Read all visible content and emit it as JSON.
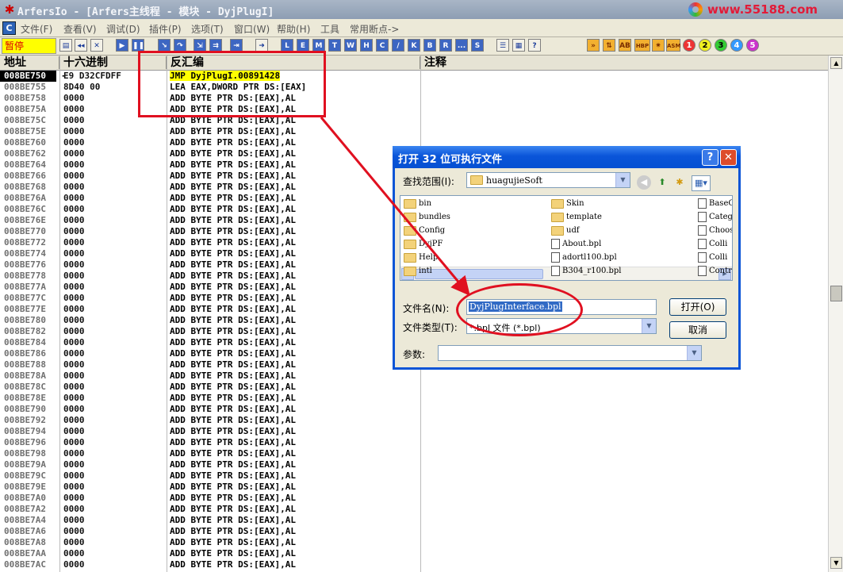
{
  "window": {
    "title": "ArfersIo - [Arfers主线程 - 模块 - DyjPlugI]",
    "watermark": "www.55188.com"
  },
  "menu": [
    "文件(F)",
    "查看(V)",
    "调试(D)",
    "插件(P)",
    "选项(T)",
    "窗口(W)",
    "帮助(H)",
    "工具",
    "常用断点->"
  ],
  "toolbar": {
    "status": "暂停",
    "letter_buttons": [
      "L",
      "E",
      "M",
      "T",
      "W",
      "H",
      "C",
      "/",
      "K",
      "B",
      "R",
      "...",
      "S"
    ],
    "right_buttons": [
      "HBP",
      "ASM",
      "1",
      "2",
      "3",
      "4",
      "5"
    ]
  },
  "columns": {
    "address": "地址",
    "hex": "十六进制",
    "disasm": "反汇编",
    "comment": "注释"
  },
  "rows": [
    {
      "addr": "008BE750",
      "mark": "-",
      "hex": "E9 D32CFDFF",
      "dis": "JMP DyjPlugI.00891428",
      "sel": true
    },
    {
      "addr": "008BE755",
      "hex": "8D40 00",
      "dis": "LEA EAX,DWORD PTR DS:[EAX]"
    },
    {
      "addr": "008BE758",
      "hex": "0000",
      "dis": "ADD BYTE PTR DS:[EAX],AL"
    },
    {
      "addr": "008BE75A",
      "hex": "0000",
      "dis": "ADD BYTE PTR DS:[EAX],AL"
    },
    {
      "addr": "008BE75C",
      "hex": "0000",
      "dis": "ADD BYTE PTR DS:[EAX],AL"
    },
    {
      "addr": "008BE75E",
      "hex": "0000",
      "dis": "ADD BYTE PTR DS:[EAX],AL"
    },
    {
      "addr": "008BE760",
      "hex": "0000",
      "dis": "ADD BYTE PTR DS:[EAX],AL"
    },
    {
      "addr": "008BE762",
      "hex": "0000",
      "dis": "ADD BYTE PTR DS:[EAX],AL"
    },
    {
      "addr": "008BE764",
      "hex": "0000",
      "dis": "ADD BYTE PTR DS:[EAX],AL"
    },
    {
      "addr": "008BE766",
      "hex": "0000",
      "dis": "ADD BYTE PTR DS:[EAX],AL"
    },
    {
      "addr": "008BE768",
      "hex": "0000",
      "dis": "ADD BYTE PTR DS:[EAX],AL"
    },
    {
      "addr": "008BE76A",
      "hex": "0000",
      "dis": "ADD BYTE PTR DS:[EAX],AL"
    },
    {
      "addr": "008BE76C",
      "hex": "0000",
      "dis": "ADD BYTE PTR DS:[EAX],AL"
    },
    {
      "addr": "008BE76E",
      "hex": "0000",
      "dis": "ADD BYTE PTR DS:[EAX],AL"
    },
    {
      "addr": "008BE770",
      "hex": "0000",
      "dis": "ADD BYTE PTR DS:[EAX],AL"
    },
    {
      "addr": "008BE772",
      "hex": "0000",
      "dis": "ADD BYTE PTR DS:[EAX],AL"
    },
    {
      "addr": "008BE774",
      "hex": "0000",
      "dis": "ADD BYTE PTR DS:[EAX],AL"
    },
    {
      "addr": "008BE776",
      "hex": "0000",
      "dis": "ADD BYTE PTR DS:[EAX],AL"
    },
    {
      "addr": "008BE778",
      "hex": "0000",
      "dis": "ADD BYTE PTR DS:[EAX],AL"
    },
    {
      "addr": "008BE77A",
      "hex": "0000",
      "dis": "ADD BYTE PTR DS:[EAX],AL"
    },
    {
      "addr": "008BE77C",
      "hex": "0000",
      "dis": "ADD BYTE PTR DS:[EAX],AL"
    },
    {
      "addr": "008BE77E",
      "hex": "0000",
      "dis": "ADD BYTE PTR DS:[EAX],AL"
    },
    {
      "addr": "008BE780",
      "hex": "0000",
      "dis": "ADD BYTE PTR DS:[EAX],AL"
    },
    {
      "addr": "008BE782",
      "hex": "0000",
      "dis": "ADD BYTE PTR DS:[EAX],AL"
    },
    {
      "addr": "008BE784",
      "hex": "0000",
      "dis": "ADD BYTE PTR DS:[EAX],AL"
    },
    {
      "addr": "008BE786",
      "hex": "0000",
      "dis": "ADD BYTE PTR DS:[EAX],AL"
    },
    {
      "addr": "008BE788",
      "hex": "0000",
      "dis": "ADD BYTE PTR DS:[EAX],AL"
    },
    {
      "addr": "008BE78A",
      "hex": "0000",
      "dis": "ADD BYTE PTR DS:[EAX],AL"
    },
    {
      "addr": "008BE78C",
      "hex": "0000",
      "dis": "ADD BYTE PTR DS:[EAX],AL"
    },
    {
      "addr": "008BE78E",
      "hex": "0000",
      "dis": "ADD BYTE PTR DS:[EAX],AL"
    },
    {
      "addr": "008BE790",
      "hex": "0000",
      "dis": "ADD BYTE PTR DS:[EAX],AL"
    },
    {
      "addr": "008BE792",
      "hex": "0000",
      "dis": "ADD BYTE PTR DS:[EAX],AL"
    },
    {
      "addr": "008BE794",
      "hex": "0000",
      "dis": "ADD BYTE PTR DS:[EAX],AL"
    },
    {
      "addr": "008BE796",
      "hex": "0000",
      "dis": "ADD BYTE PTR DS:[EAX],AL"
    },
    {
      "addr": "008BE798",
      "hex": "0000",
      "dis": "ADD BYTE PTR DS:[EAX],AL"
    },
    {
      "addr": "008BE79A",
      "hex": "0000",
      "dis": "ADD BYTE PTR DS:[EAX],AL"
    },
    {
      "addr": "008BE79C",
      "hex": "0000",
      "dis": "ADD BYTE PTR DS:[EAX],AL"
    },
    {
      "addr": "008BE79E",
      "hex": "0000",
      "dis": "ADD BYTE PTR DS:[EAX],AL"
    },
    {
      "addr": "008BE7A0",
      "hex": "0000",
      "dis": "ADD BYTE PTR DS:[EAX],AL"
    },
    {
      "addr": "008BE7A2",
      "hex": "0000",
      "dis": "ADD BYTE PTR DS:[EAX],AL"
    },
    {
      "addr": "008BE7A4",
      "hex": "0000",
      "dis": "ADD BYTE PTR DS:[EAX],AL"
    },
    {
      "addr": "008BE7A6",
      "hex": "0000",
      "dis": "ADD BYTE PTR DS:[EAX],AL"
    },
    {
      "addr": "008BE7A8",
      "hex": "0000",
      "dis": "ADD BYTE PTR DS:[EAX],AL"
    },
    {
      "addr": "008BE7AA",
      "hex": "0000",
      "dis": "ADD BYTE PTR DS:[EAX],AL"
    },
    {
      "addr": "008BE7AC",
      "hex": "0000",
      "dis": "ADD BYTE PTR DS:[EAX],AL"
    }
  ],
  "dialog": {
    "title": "打开 32 位可执行文件",
    "lookin_label": "查找范围(I):",
    "lookin_value": "huagujieSoft",
    "files_col1": [
      "bin",
      "bundles",
      "Config",
      "DyjPF",
      "Help",
      "intl"
    ],
    "files_col2": [
      {
        "name": "Skin",
        "type": "folder"
      },
      {
        "name": "template",
        "type": "folder"
      },
      {
        "name": "udf",
        "type": "folder"
      },
      {
        "name": "About.bpl",
        "type": "file"
      },
      {
        "name": "adortl100.bpl",
        "type": "file"
      },
      {
        "name": "B304_r100.bpl",
        "type": "file"
      }
    ],
    "files_col3": [
      "BaseG",
      "Categ",
      "Choos",
      "Colli",
      "Colli",
      "Contr"
    ],
    "filename_label": "文件名(N):",
    "filename_value": "DyjPlugInterface.bpl",
    "filetype_label": "文件类型(T):",
    "filetype_value": "*.bpl 文件 (*.bpl)",
    "params_label": "参数:",
    "params_value": "",
    "open_button": "打开(O)",
    "cancel_button": "取消"
  }
}
